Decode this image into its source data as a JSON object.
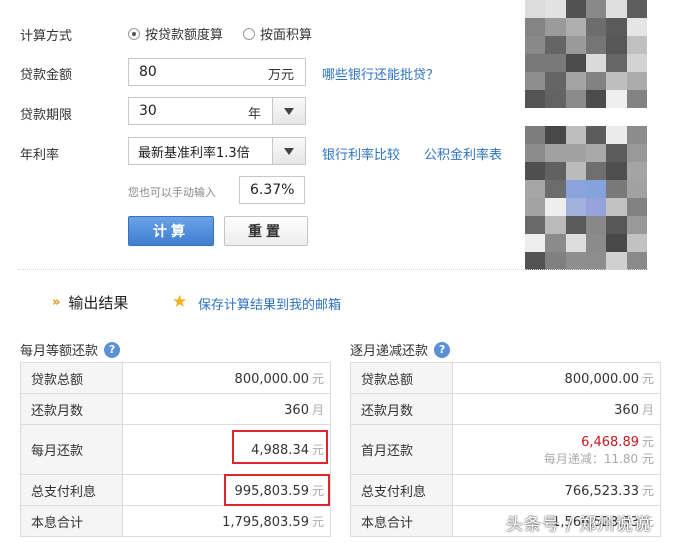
{
  "form": {
    "calc_method_label": "计算方式",
    "method_options": [
      "按贷款额度算",
      "按面积算"
    ],
    "selected_method": 0,
    "loan_amount_label": "贷款金额",
    "loan_amount_value": "80",
    "loan_amount_unit": "万元",
    "banks_link": "哪些银行还能批贷？",
    "loan_term_label": "贷款期限",
    "loan_term_value": "30",
    "loan_term_unit": "年",
    "rate_label": "年利率",
    "rate_selected": "最新基准利率1.3倍",
    "bank_rate_link": "银行利率比较",
    "fund_rate_link": "公积金利率表",
    "manual_hint": "您也可以手动输入",
    "manual_rate_value": "6.37%",
    "calc_button": "计算",
    "reset_button": "重置"
  },
  "output": {
    "title": "输出结果",
    "save_link": "保存计算结果到我的邮箱"
  },
  "equal_payment": {
    "title": "每月等额还款",
    "rows": [
      {
        "key": "贷款总额",
        "value": "800,000.00",
        "unit": "元"
      },
      {
        "key": "还款月数",
        "value": "360",
        "unit": "月"
      },
      {
        "key": "每月还款",
        "value": "4,988.34",
        "unit": "元"
      },
      {
        "key": "总支付利息",
        "value": "995,803.59",
        "unit": "元"
      },
      {
        "key": "本息合计",
        "value": "1,795,803.59",
        "unit": "元"
      }
    ]
  },
  "decreasing_payment": {
    "title": "逐月递减还款",
    "rows": [
      {
        "key": "贷款总额",
        "value": "800,000.00",
        "unit": "元"
      },
      {
        "key": "还款月数",
        "value": "360",
        "unit": "月"
      },
      {
        "key": "首月还款",
        "value": "6,468.89",
        "unit": "元"
      },
      {
        "key": "总支付利息",
        "value": "766,523.33",
        "unit": "元"
      },
      {
        "key": "本息合计",
        "value": "1,566,523.33",
        "unit": "元"
      }
    ],
    "monthly_decrease": "每月递减：11.80 元"
  },
  "watermark": "头条号 / 郑州说说",
  "colors": {
    "accent_blue": "#2e73c0",
    "button_blue": "#4a88d8",
    "value_red": "#c8161d",
    "highlight_red": "#d9282e"
  }
}
